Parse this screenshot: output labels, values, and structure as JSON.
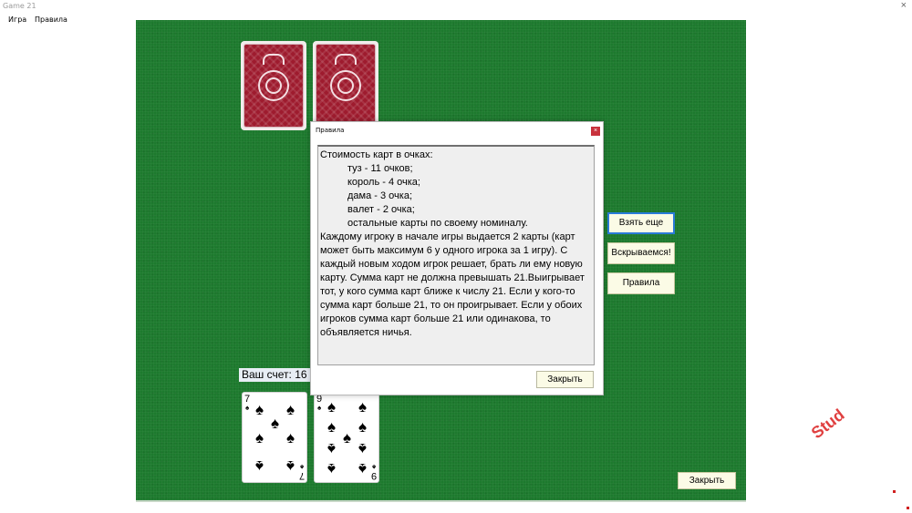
{
  "app": {
    "title": "Game 21"
  },
  "menu": {
    "items": [
      "Игра",
      "Правила"
    ]
  },
  "score": {
    "label": "Ваш счет: 16"
  },
  "player_cards": [
    {
      "rank": "7",
      "suit": "spades"
    },
    {
      "rank": "9",
      "suit": "spades"
    }
  ],
  "dealer_cards": {
    "count": 2,
    "face": "back"
  },
  "side_buttons": {
    "take": "Взять еще",
    "reveal": "Вскрываемся!",
    "rules": "Правила"
  },
  "bottom_button": {
    "close": "Закрыть"
  },
  "dialog": {
    "title": "Правила",
    "close_icon": "×",
    "lines": {
      "heading": "Стоимость карт в очках:",
      "ace": "туз - 11 очков;",
      "king": "король - 4 очка;",
      "queen": "дама - 3 очка;",
      "jack": "валет - 2 очка;",
      "others": "остальные карты по своему номиналу."
    },
    "paragraph": "Каждому игроку в начале игры выдается 2 карты (карт может быть максимум 6 у одного игрока за 1 игру). С каждый новым ходом игрок решает, брать ли ему новую карту. Сумма карт не должна превышать 21.Выигрывает тот, у кого сумма карт ближе к числу 21. Если у кого-то сумма карт больше 21, то он проигрывает. Если у обоих игроков сумма карт больше 21 или одинакова, то объявляется ничья.",
    "close_button": "Закрыть"
  },
  "watermark": {
    "text": "Stud"
  },
  "colors": {
    "table": "#1d7a2e",
    "card_back": "#9e1b2e",
    "button": "#fbfbe6",
    "focus": "#2a7bd8"
  }
}
